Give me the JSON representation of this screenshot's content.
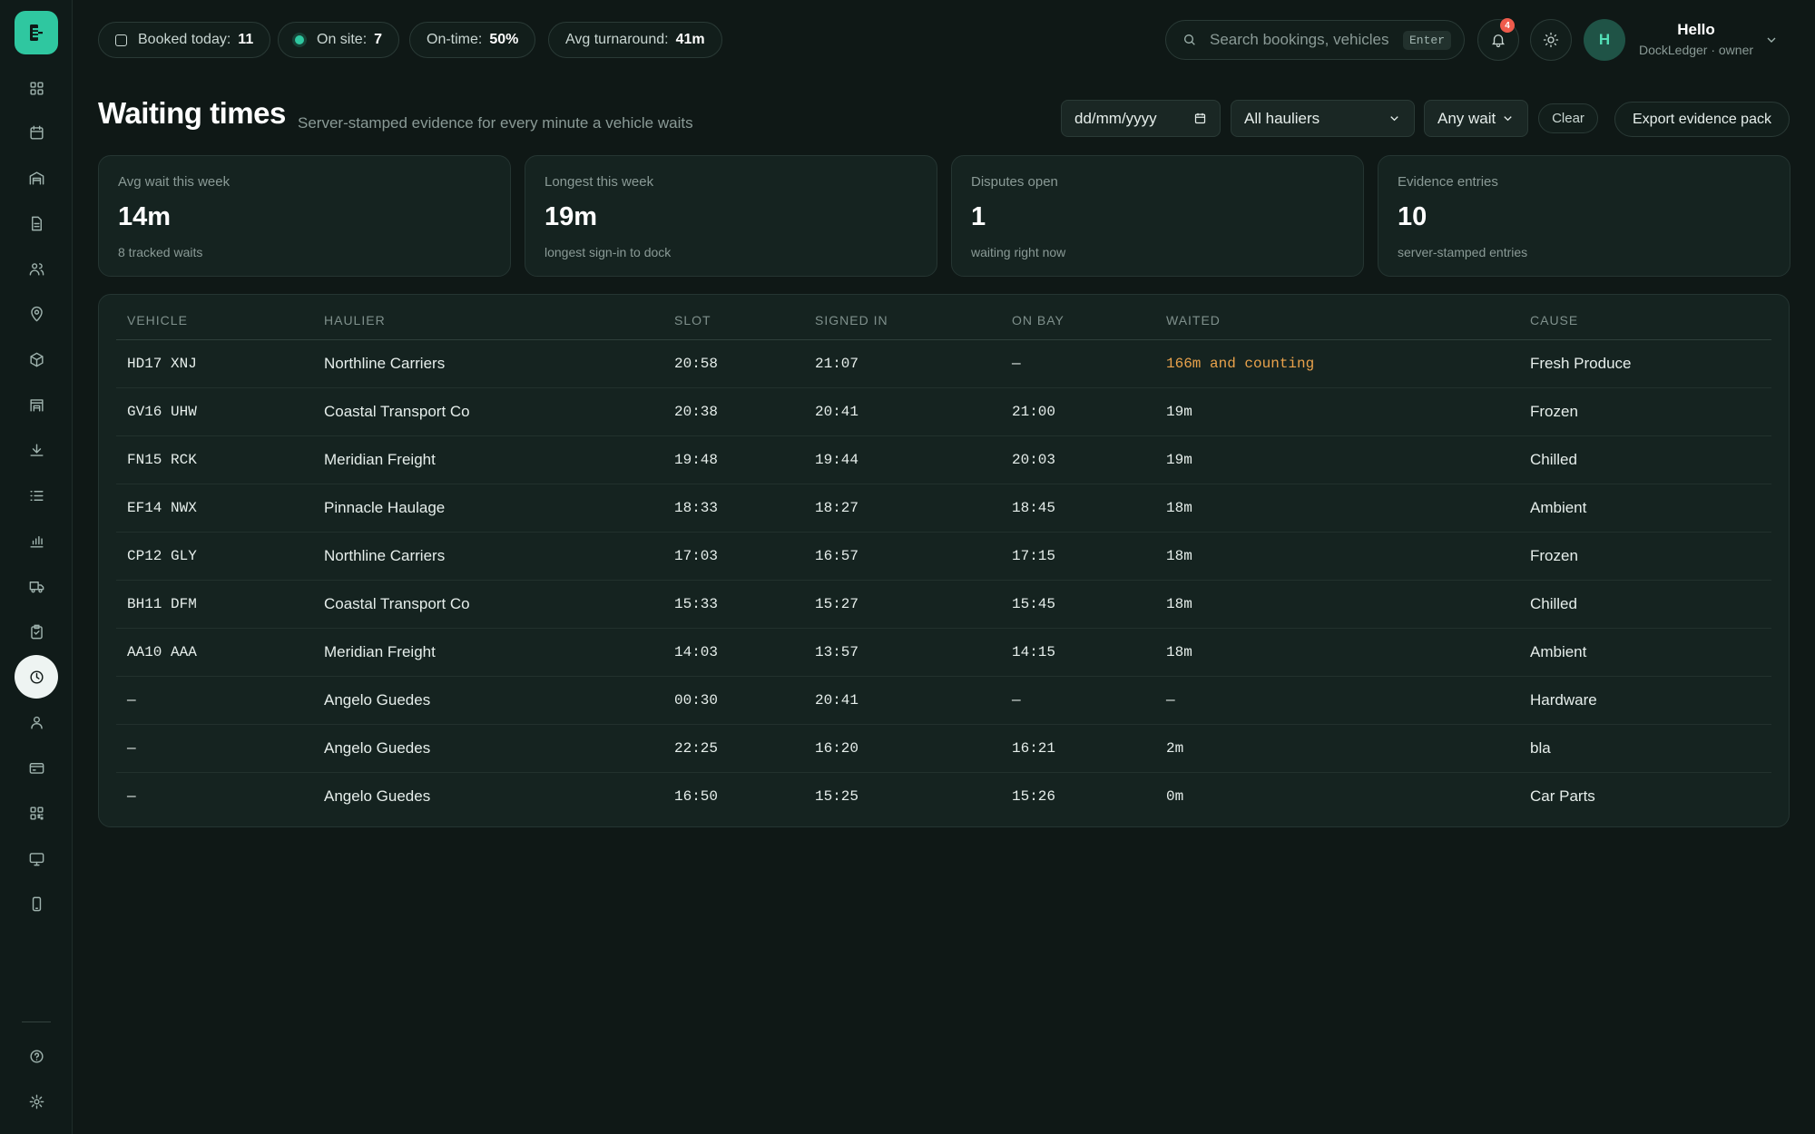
{
  "topbar": {
    "booked": {
      "label": "Booked today:",
      "value": "11"
    },
    "onsite": {
      "label": "On site:",
      "value": "7"
    },
    "ontime": {
      "label": "On-time:",
      "value": "50%"
    },
    "turnaround": {
      "label": "Avg turnaround:",
      "value": "41m"
    },
    "search_placeholder": "Search bookings, vehicles",
    "search_key": "Enter",
    "notifications_count": "4",
    "user_greeting": "Hello",
    "user_sub": "DockLedger · owner"
  },
  "sidebar": {
    "items": [
      "grid-icon",
      "calendar-icon",
      "warehouse-icon",
      "document-icon",
      "users-icon",
      "location-icon",
      "package-icon",
      "factory-icon",
      "download-icon",
      "list-icon",
      "chart-icon",
      "truck-icon",
      "clipboard-icon",
      "clock-icon",
      "user-icon",
      "card-icon",
      "qr-icon",
      "monitor-icon",
      "phone-icon"
    ],
    "active": "clock-icon"
  },
  "header": {
    "title": "Waiting times",
    "subtitle": "Server-stamped evidence for every minute a vehicle waits",
    "date_placeholder": "dd/mm/yyyy",
    "haulier_select": "All hauliers",
    "wait_select": "Any wait",
    "clear_label": "Clear",
    "export_label": "Export evidence pack"
  },
  "stats": [
    {
      "label": "Avg wait this week",
      "value": "14m",
      "note": "8 tracked waits"
    },
    {
      "label": "Longest this week",
      "value": "19m",
      "note": "longest sign-in to dock"
    },
    {
      "label": "Disputes open",
      "value": "1",
      "note": "waiting right now"
    },
    {
      "label": "Evidence entries",
      "value": "10",
      "note": "server-stamped entries"
    }
  ],
  "table": {
    "columns": [
      "VEHICLE",
      "HAULIER",
      "SLOT",
      "SIGNED IN",
      "ON BAY",
      "WAITED",
      "CAUSE"
    ],
    "rows": [
      {
        "vehicle": "HD17 XNJ",
        "haulier": "Northline Carriers",
        "slot": "20:58",
        "signed_in": "21:07",
        "on_bay": "—",
        "waited": "166m and counting",
        "cause": "Fresh Produce"
      },
      {
        "vehicle": "GV16 UHW",
        "haulier": "Coastal Transport Co",
        "slot": "20:38",
        "signed_in": "20:41",
        "on_bay": "21:00",
        "waited": "19m",
        "cause": "Frozen"
      },
      {
        "vehicle": "FN15 RCK",
        "haulier": "Meridian Freight",
        "slot": "19:48",
        "signed_in": "19:44",
        "on_bay": "20:03",
        "waited": "19m",
        "cause": "Chilled"
      },
      {
        "vehicle": "EF14 NWX",
        "haulier": "Pinnacle Haulage",
        "slot": "18:33",
        "signed_in": "18:27",
        "on_bay": "18:45",
        "waited": "18m",
        "cause": "Ambient"
      },
      {
        "vehicle": "CP12 GLY",
        "haulier": "Northline Carriers",
        "slot": "17:03",
        "signed_in": "16:57",
        "on_bay": "17:15",
        "waited": "18m",
        "cause": "Frozen"
      },
      {
        "vehicle": "BH11 DFM",
        "haulier": "Coastal Transport Co",
        "slot": "15:33",
        "signed_in": "15:27",
        "on_bay": "15:45",
        "waited": "18m",
        "cause": "Chilled"
      },
      {
        "vehicle": "AA10 AAA",
        "haulier": "Meridian Freight",
        "slot": "14:03",
        "signed_in": "13:57",
        "on_bay": "14:15",
        "waited": "18m",
        "cause": "Ambient"
      },
      {
        "vehicle": "—",
        "haulier": "Angelo Guedes",
        "slot": "00:30",
        "signed_in": "20:41",
        "on_bay": "—",
        "waited": "—",
        "cause": "Hardware"
      },
      {
        "vehicle": "—",
        "haulier": "Angelo Guedes",
        "slot": "22:25",
        "signed_in": "16:20",
        "on_bay": "16:21",
        "waited": "2m",
        "cause": "bla"
      },
      {
        "vehicle": "—",
        "haulier": "Angelo Guedes",
        "slot": "16:50",
        "signed_in": "15:25",
        "on_bay": "15:26",
        "waited": "0m",
        "cause": "Car Parts"
      }
    ]
  },
  "colors": {
    "accent": "#2fc7a0",
    "warning": "#e9a24b",
    "background": "#0f1816",
    "card": "#152320"
  }
}
